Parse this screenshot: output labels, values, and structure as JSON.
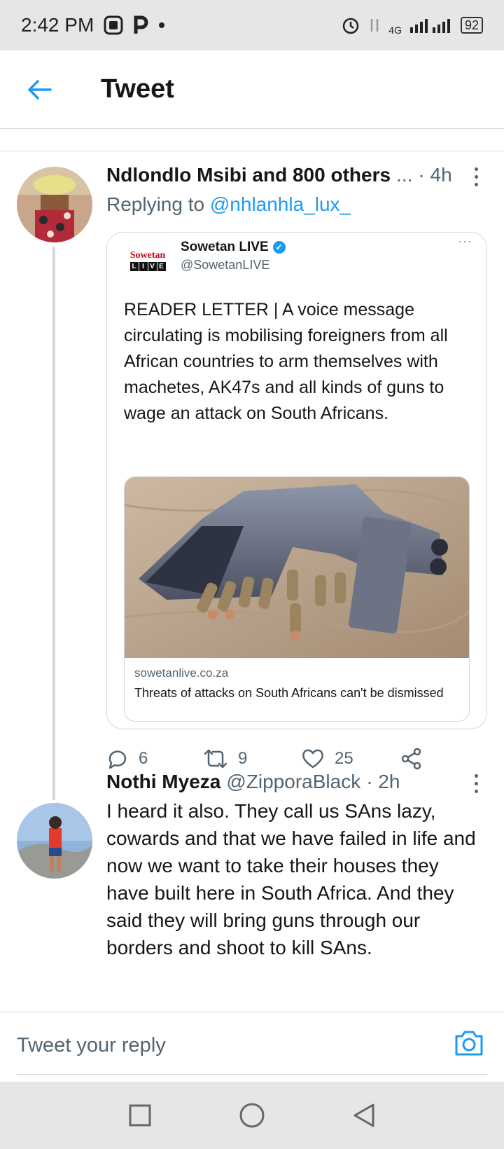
{
  "status_bar": {
    "time": "2:42 PM",
    "network": "4G",
    "battery": "92"
  },
  "header": {
    "title": "Tweet"
  },
  "tweet1": {
    "name": "Ndlondlo Msibi and 800 others",
    "ellipsis": "...",
    "time": "· 4h",
    "replying_prefix": "Replying to",
    "replying_handle": "@nhlanhla_lux_",
    "quote": {
      "logo_top": "Sowetan",
      "logo_bottom": [
        "L",
        "I",
        "V",
        "E"
      ],
      "name": "Sowetan LIVE",
      "handle": "@SowetanLIVE",
      "text": "READER LETTER | A voice message circulating is mobilising foreigners from all African countries to arm themselves with machetes, AK47s and all kinds of guns to wage an attack on South Africans.",
      "link_domain": "sowetanlive.co.za",
      "link_title": "Threats of attacks on South Africans can't be dismissed"
    },
    "actions": {
      "replies": "6",
      "retweets": "9",
      "likes": "25"
    }
  },
  "tweet2": {
    "name": "Nothi Myeza",
    "handle": "@ZipporaBlack",
    "time": "· 2h",
    "text": "I heard it also. They call us SAns lazy, cowards and that we have failed in life and now we want to take their houses they have built here in South Africa. And they said they will bring guns through our borders and shoot to kill SAns."
  },
  "compose": {
    "placeholder": "Tweet your reply"
  },
  "colors": {
    "accent": "#1d9bf0",
    "secondary_text": "#536471",
    "border": "#cfd9de"
  }
}
